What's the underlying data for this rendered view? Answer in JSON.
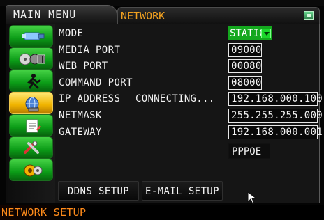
{
  "header": {
    "main_menu": "MAIN MENU",
    "tab_title": "NETWORK"
  },
  "sidebar": {
    "items": [
      {
        "icon": "camera-icon"
      },
      {
        "icon": "film-icon"
      },
      {
        "icon": "running-man-icon"
      },
      {
        "icon": "network-globe-icon"
      },
      {
        "icon": "document-icon"
      },
      {
        "icon": "tools-icon"
      },
      {
        "icon": "settings-gears-icon"
      }
    ],
    "active_index": 3
  },
  "form": {
    "mode_label": "MODE",
    "mode_value": "STATIC",
    "media_port_label": "MEDIA PORT",
    "media_port_value": "09000",
    "web_port_label": "WEB   PORT",
    "web_port_value": "00080",
    "command_port_label": "COMMAND PORT",
    "command_port_value": "08000",
    "ip_label": "IP ADDRESS",
    "ip_status": "CONNECTING...",
    "ip_value": "192.168.000.100",
    "netmask_label": "NETMASK",
    "netmask_value": "255.255.255.000",
    "gateway_label": "GATEWAY",
    "gateway_value": "192.168.000.001",
    "pppoe_label": "PPPOE"
  },
  "buttons": {
    "ddns": "DDNS  SETUP",
    "email": "E-MAIL SETUP"
  },
  "status": {
    "text": "NETWORK  SETUP"
  },
  "colors": {
    "accent_orange": "#f0a020",
    "sidebar_green": "#14a81e",
    "active_yellow": "#f1b400",
    "status_orange": "#ff8b1a"
  }
}
